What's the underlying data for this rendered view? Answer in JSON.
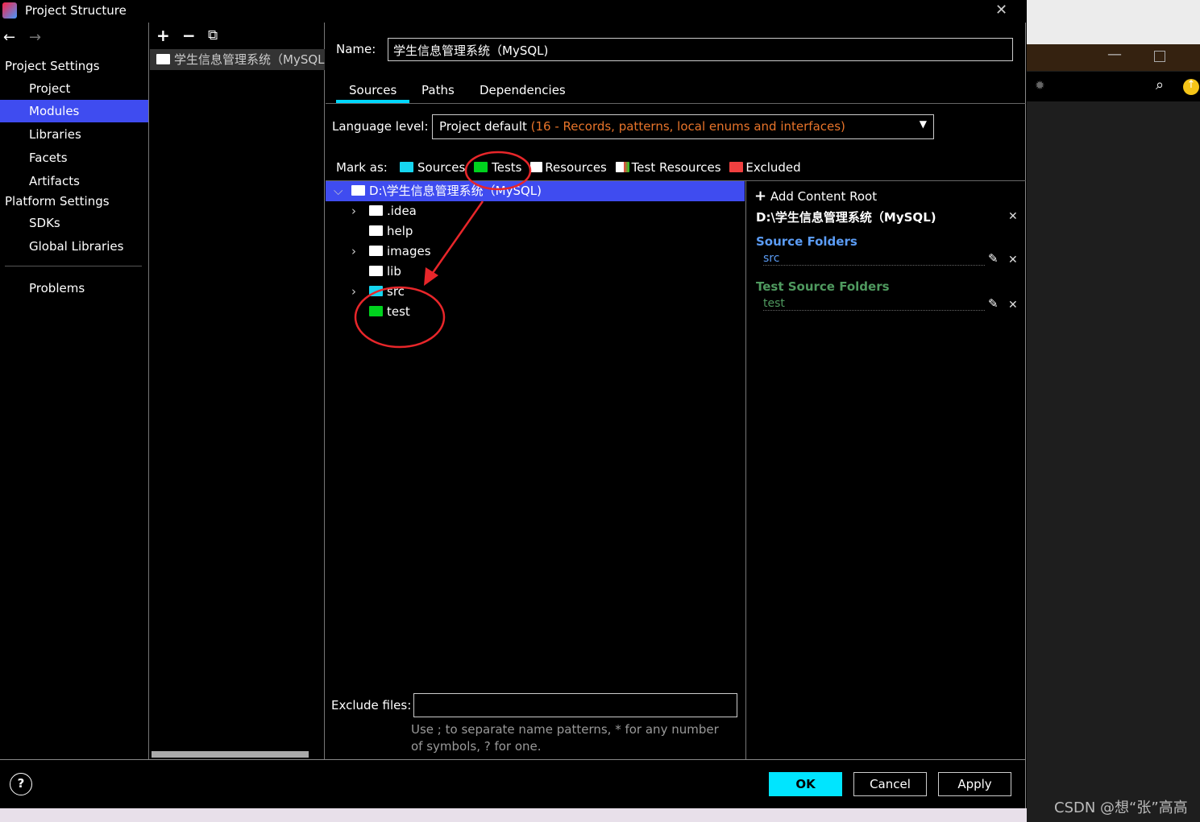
{
  "window": {
    "title": "Project Structure",
    "close": "✕"
  },
  "nav": {
    "back": "←",
    "forward": "→",
    "project_settings": "Project Settings",
    "items": [
      "Project",
      "Modules",
      "Libraries",
      "Facets",
      "Artifacts"
    ],
    "platform_settings": "Platform Settings",
    "platform_items": [
      "SDKs",
      "Global Libraries"
    ],
    "problems": "Problems",
    "selected": "Modules"
  },
  "modules": {
    "add": "+",
    "remove": "−",
    "copy": "⧉",
    "items": [
      "学生信息管理系统（MySQL)"
    ]
  },
  "module": {
    "name_label": "Name:",
    "name_value": "学生信息管理系统（MySQL)",
    "tabs": [
      "Sources",
      "Paths",
      "Dependencies"
    ],
    "active_tab": "Sources",
    "language_label": "Language level:",
    "language_value": "Project default",
    "language_detail": "(16 - Records, patterns, local enums and interfaces)",
    "mark_as_label": "Mark as:",
    "mark_as": [
      {
        "label": "Sources",
        "color": "#16d6f0"
      },
      {
        "label": "Tests",
        "color": "#00d21e"
      },
      {
        "label": "Resources",
        "color": "#ffffff"
      },
      {
        "label": "Test Resources",
        "color": "#ffffff"
      },
      {
        "label": "Excluded",
        "color": "#f04040"
      }
    ],
    "tree": [
      {
        "label": "D:\\学生信息管理系统（MySQL)",
        "expanded": true,
        "level": 0,
        "color": "#ffffff",
        "selected": true
      },
      {
        "label": ".idea",
        "level": 1,
        "expandable": true,
        "color": "#ffffff"
      },
      {
        "label": "help",
        "level": 1,
        "color": "#ffffff"
      },
      {
        "label": "images",
        "level": 1,
        "expandable": true,
        "color": "#ffffff"
      },
      {
        "label": "lib",
        "level": 1,
        "color": "#ffffff"
      },
      {
        "label": "src",
        "level": 1,
        "expandable": true,
        "color": "#16d6f0"
      },
      {
        "label": "test",
        "level": 1,
        "color": "#00d21e"
      }
    ],
    "exclude_label": "Exclude files:",
    "exclude_value": "",
    "exclude_hint": "Use ; to separate name patterns, * for any number of symbols, ? for one."
  },
  "roots": {
    "add": "Add Content Root",
    "root": "D:\\学生信息管理系统（MySQL)",
    "source_header": "Source Folders",
    "source_items": [
      "src"
    ],
    "test_header": "Test Source Folders",
    "test_items": [
      "test"
    ]
  },
  "footer": {
    "help": "?",
    "ok": "OK",
    "cancel": "Cancel",
    "apply": "Apply"
  },
  "watermark": "CSDN @想“张”高高",
  "colors": {
    "selection": "#3f4cf0",
    "ok": "#00e5ff",
    "source": "#5b9cf5",
    "test": "#4f9a5f",
    "language_detail": "#e8742a",
    "annotation": "#e8262a"
  }
}
